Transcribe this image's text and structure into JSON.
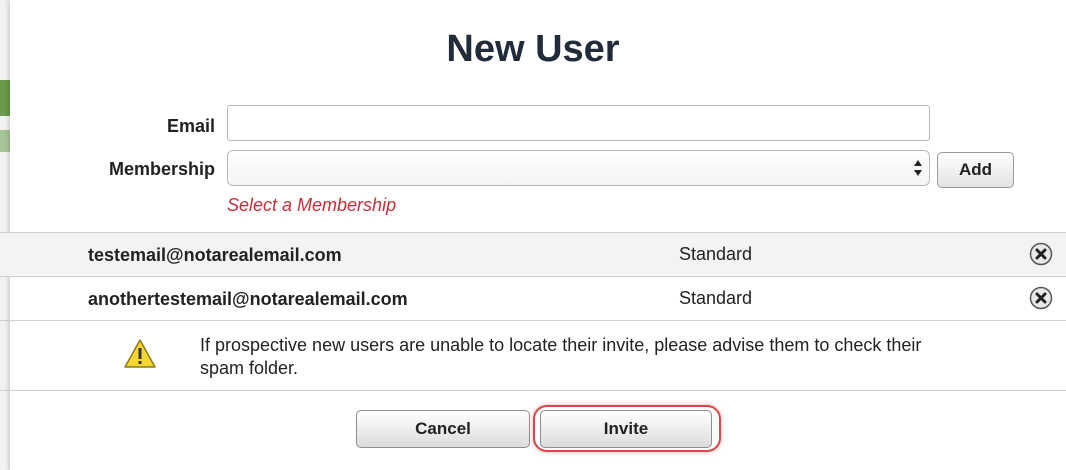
{
  "dialog": {
    "title": "New User"
  },
  "form": {
    "email_label": "Email",
    "email_value": "",
    "membership_label": "Membership",
    "membership_value": "",
    "add_label": "Add",
    "validation_message": "Select a Membership"
  },
  "users": [
    {
      "email": "testemail@notarealemail.com",
      "membership": "Standard"
    },
    {
      "email": "anothertestemail@notarealemail.com",
      "membership": "Standard"
    }
  ],
  "notice": {
    "text": "If prospective new users are unable to locate their invite, please advise them to check their spam folder."
  },
  "footer": {
    "cancel_label": "Cancel",
    "invite_label": "Invite"
  },
  "icons": {
    "remove": "close-circle-icon",
    "warning": "warning-triangle-icon",
    "select_arrows": "select-arrows-icon"
  },
  "colors": {
    "error_text": "#c4303a",
    "highlight_outline": "#d6484a",
    "warning_fill": "#f5d630"
  }
}
